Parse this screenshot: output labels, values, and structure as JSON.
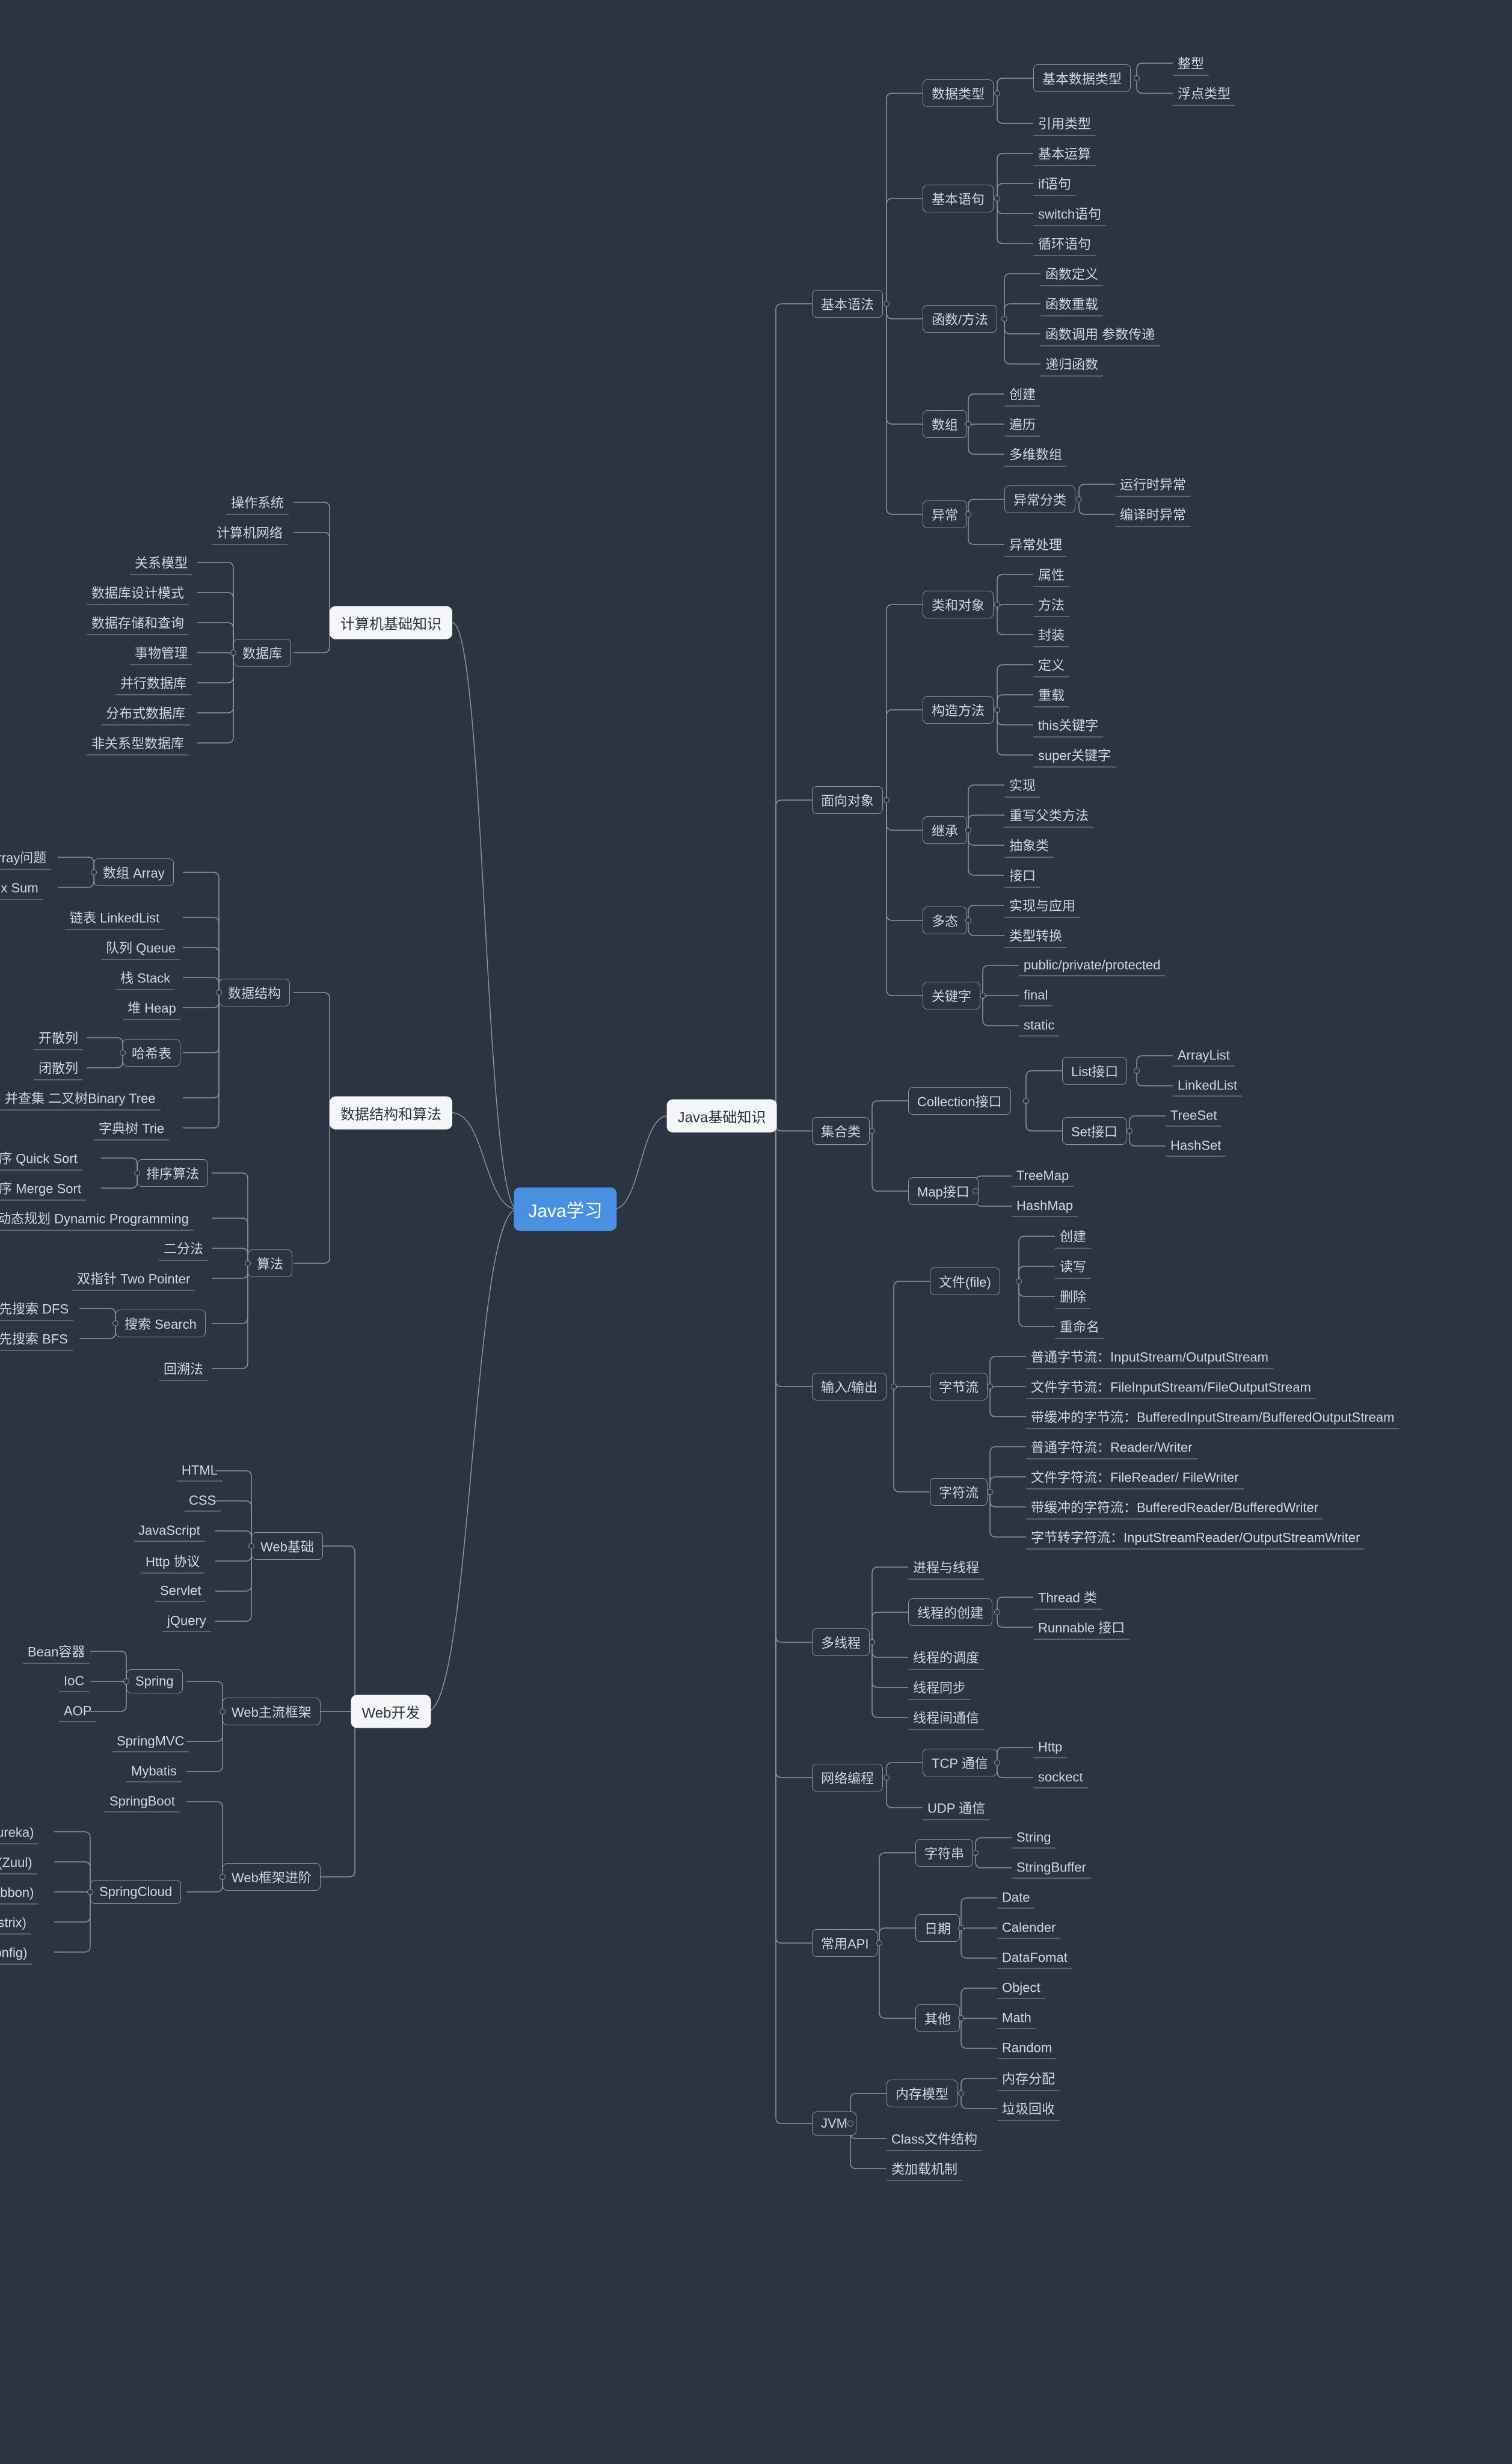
{
  "chart_data": {
    "type": "mindmap",
    "root": "Java学习",
    "branches": [
      {
        "side": "left",
        "label": "计算机基础知识",
        "children": [
          {
            "label": "操作系统"
          },
          {
            "label": "计算机网络"
          },
          {
            "label": "数据库",
            "children": [
              {
                "label": "关系模型"
              },
              {
                "label": "数据库设计模式"
              },
              {
                "label": "数据存储和查询"
              },
              {
                "label": "事物管理"
              },
              {
                "label": "并行数据库"
              },
              {
                "label": "分布式数据库"
              },
              {
                "label": "非关系型数据库"
              }
            ]
          }
        ]
      },
      {
        "side": "left",
        "label": "数据结构和算法",
        "children": [
          {
            "label": "数据结构",
            "children": [
              {
                "label": "数组 Array",
                "children": [
                  {
                    "label": "Subarray问题"
                  },
                  {
                    "label": "前缀和 Prefix Sum"
                  }
                ]
              },
              {
                "label": "链表 LinkedList"
              },
              {
                "label": "队列 Queue"
              },
              {
                "label": "栈 Stack"
              },
              {
                "label": "堆 Heap"
              },
              {
                "label": "哈希表",
                "children": [
                  {
                    "label": "开散列"
                  },
                  {
                    "label": "闭散列"
                  }
                ]
              },
              {
                "label": "并查集 二叉树Binary Tree"
              },
              {
                "label": "字典树 Trie"
              }
            ]
          },
          {
            "label": "算法",
            "children": [
              {
                "label": "排序算法",
                "children": [
                  {
                    "label": "快速排序 Quick Sort"
                  },
                  {
                    "label": "归并排序 Merge Sort"
                  }
                ]
              },
              {
                "label": "动态规划 Dynamic  Programming"
              },
              {
                "label": "二分法"
              },
              {
                "label": "双指针 Two Pointer"
              },
              {
                "label": "搜索 Search",
                "children": [
                  {
                    "label": "深度优先搜索 DFS"
                  },
                  {
                    "label": "广度优先搜索 BFS"
                  }
                ]
              },
              {
                "label": "回溯法"
              }
            ]
          }
        ]
      },
      {
        "side": "left",
        "label": "Web开发",
        "children": [
          {
            "label": "Web基础",
            "children": [
              {
                "label": "HTML"
              },
              {
                "label": "CSS"
              },
              {
                "label": "JavaScript"
              },
              {
                "label": "Http 协议"
              },
              {
                "label": "Servlet"
              },
              {
                "label": "jQuery"
              }
            ]
          },
          {
            "label": "Web主流框架",
            "children": [
              {
                "label": "Spring",
                "children": [
                  {
                    "label": "Bean容器"
                  },
                  {
                    "label": "IoC"
                  },
                  {
                    "label": "AOP"
                  }
                ]
              },
              {
                "label": "SpringMVC"
              },
              {
                "label": "Mybatis"
              }
            ]
          },
          {
            "label": "Web框架进阶",
            "children": [
              {
                "label": "SpringBoot"
              },
              {
                "label": "SpringCloud",
                "children": [
                  {
                    "label": "服务发现 (Eureka)"
                  },
                  {
                    "label": "服务网关 (Zuul)"
                  },
                  {
                    "label": "负载均衡 (Ribbon)"
                  },
                  {
                    "label": "断路器 (Hystrix)"
                  },
                  {
                    "label": "配置管理 (config)"
                  }
                ]
              }
            ]
          }
        ]
      },
      {
        "side": "right",
        "label": "Java基础知识",
        "children": [
          {
            "label": "基本语法",
            "children": [
              {
                "label": "数据类型",
                "children": [
                  {
                    "label": "基本数据类型",
                    "children": [
                      {
                        "label": "整型"
                      },
                      {
                        "label": "浮点类型"
                      }
                    ]
                  },
                  {
                    "label": "引用类型"
                  }
                ]
              },
              {
                "label": "基本语句",
                "children": [
                  {
                    "label": "基本运算"
                  },
                  {
                    "label": "if语句"
                  },
                  {
                    "label": "switch语句"
                  },
                  {
                    "label": "循环语句"
                  }
                ]
              },
              {
                "label": "函数/方法",
                "children": [
                  {
                    "label": "函数定义"
                  },
                  {
                    "label": "函数重载"
                  },
                  {
                    "label": "函数调用 参数传递"
                  },
                  {
                    "label": "递归函数"
                  }
                ]
              },
              {
                "label": "数组",
                "children": [
                  {
                    "label": "创建"
                  },
                  {
                    "label": "遍历"
                  },
                  {
                    "label": "多维数组"
                  }
                ]
              },
              {
                "label": "异常",
                "children": [
                  {
                    "label": "异常分类",
                    "children": [
                      {
                        "label": "运行时异常"
                      },
                      {
                        "label": "编译时异常"
                      }
                    ]
                  },
                  {
                    "label": "异常处理"
                  }
                ]
              }
            ]
          },
          {
            "label": "面向对象",
            "children": [
              {
                "label": "类和对象",
                "children": [
                  {
                    "label": "属性"
                  },
                  {
                    "label": "方法"
                  },
                  {
                    "label": "封装"
                  }
                ]
              },
              {
                "label": "构造方法",
                "children": [
                  {
                    "label": "定义"
                  },
                  {
                    "label": "重载"
                  },
                  {
                    "label": "this关键字"
                  },
                  {
                    "label": "super关键字"
                  }
                ]
              },
              {
                "label": "继承",
                "children": [
                  {
                    "label": "实现"
                  },
                  {
                    "label": "重写父类方法"
                  },
                  {
                    "label": "抽象类"
                  },
                  {
                    "label": "接口"
                  }
                ]
              },
              {
                "label": "多态",
                "children": [
                  {
                    "label": "实现与应用"
                  },
                  {
                    "label": "类型转换"
                  }
                ]
              },
              {
                "label": "关键字",
                "children": [
                  {
                    "label": "public/private/protected"
                  },
                  {
                    "label": "final"
                  },
                  {
                    "label": "static"
                  }
                ]
              }
            ]
          },
          {
            "label": "集合类",
            "children": [
              {
                "label": "Collection接口",
                "children": [
                  {
                    "label": "List接口",
                    "children": [
                      {
                        "label": "ArrayList"
                      },
                      {
                        "label": "LinkedList"
                      }
                    ]
                  },
                  {
                    "label": "Set接口",
                    "children": [
                      {
                        "label": "TreeSet"
                      },
                      {
                        "label": "HashSet"
                      }
                    ]
                  }
                ]
              },
              {
                "label": "Map接口",
                "children": [
                  {
                    "label": "TreeMap"
                  },
                  {
                    "label": "HashMap"
                  }
                ]
              }
            ]
          },
          {
            "label": "输入/输出",
            "children": [
              {
                "label": "文件(file)",
                "children": [
                  {
                    "label": "创建"
                  },
                  {
                    "label": "读写"
                  },
                  {
                    "label": "删除"
                  },
                  {
                    "label": "重命名"
                  }
                ]
              },
              {
                "label": "字节流",
                "children": [
                  {
                    "label": "普通字节流：InputStream/OutputStream"
                  },
                  {
                    "label": "文件字节流：FileInputStream/FileOutputStream"
                  },
                  {
                    "label": "带缓冲的字节流：BufferedInputStream/BufferedOutputStream"
                  }
                ]
              },
              {
                "label": "字符流",
                "children": [
                  {
                    "label": "普通字符流：Reader/Writer"
                  },
                  {
                    "label": "文件字符流：FileReader/ FileWriter"
                  },
                  {
                    "label": "带缓冲的字符流：BufferedReader/BufferedWriter"
                  },
                  {
                    "label": "字节转字符流：InputStreamReader/OutputStreamWriter"
                  }
                ]
              }
            ]
          },
          {
            "label": "多线程",
            "children": [
              {
                "label": "进程与线程"
              },
              {
                "label": "线程的创建",
                "children": [
                  {
                    "label": "Thread 类"
                  },
                  {
                    "label": "Runnable 接口"
                  }
                ]
              },
              {
                "label": "线程的调度"
              },
              {
                "label": "线程同步"
              },
              {
                "label": "线程间通信"
              }
            ]
          },
          {
            "label": "网络编程",
            "children": [
              {
                "label": "TCP 通信",
                "children": [
                  {
                    "label": "Http"
                  },
                  {
                    "label": "sockect"
                  }
                ]
              },
              {
                "label": "UDP 通信"
              }
            ]
          },
          {
            "label": "常用API",
            "children": [
              {
                "label": "字符串",
                "children": [
                  {
                    "label": "String"
                  },
                  {
                    "label": "StringBuffer"
                  }
                ]
              },
              {
                "label": "日期",
                "children": [
                  {
                    "label": "Date"
                  },
                  {
                    "label": "Calender"
                  },
                  {
                    "label": "DataFomat"
                  }
                ]
              },
              {
                "label": "其他",
                "children": [
                  {
                    "label": "Object"
                  },
                  {
                    "label": "Math"
                  },
                  {
                    "label": "Random"
                  }
                ]
              }
            ]
          },
          {
            "label": "JVM",
            "children": [
              {
                "label": "内存模型",
                "children": [
                  {
                    "label": "内存分配"
                  },
                  {
                    "label": "垃圾回收"
                  }
                ]
              },
              {
                "label": "Class文件结构"
              },
              {
                "label": "类加载机制"
              }
            ]
          }
        ]
      }
    ]
  }
}
